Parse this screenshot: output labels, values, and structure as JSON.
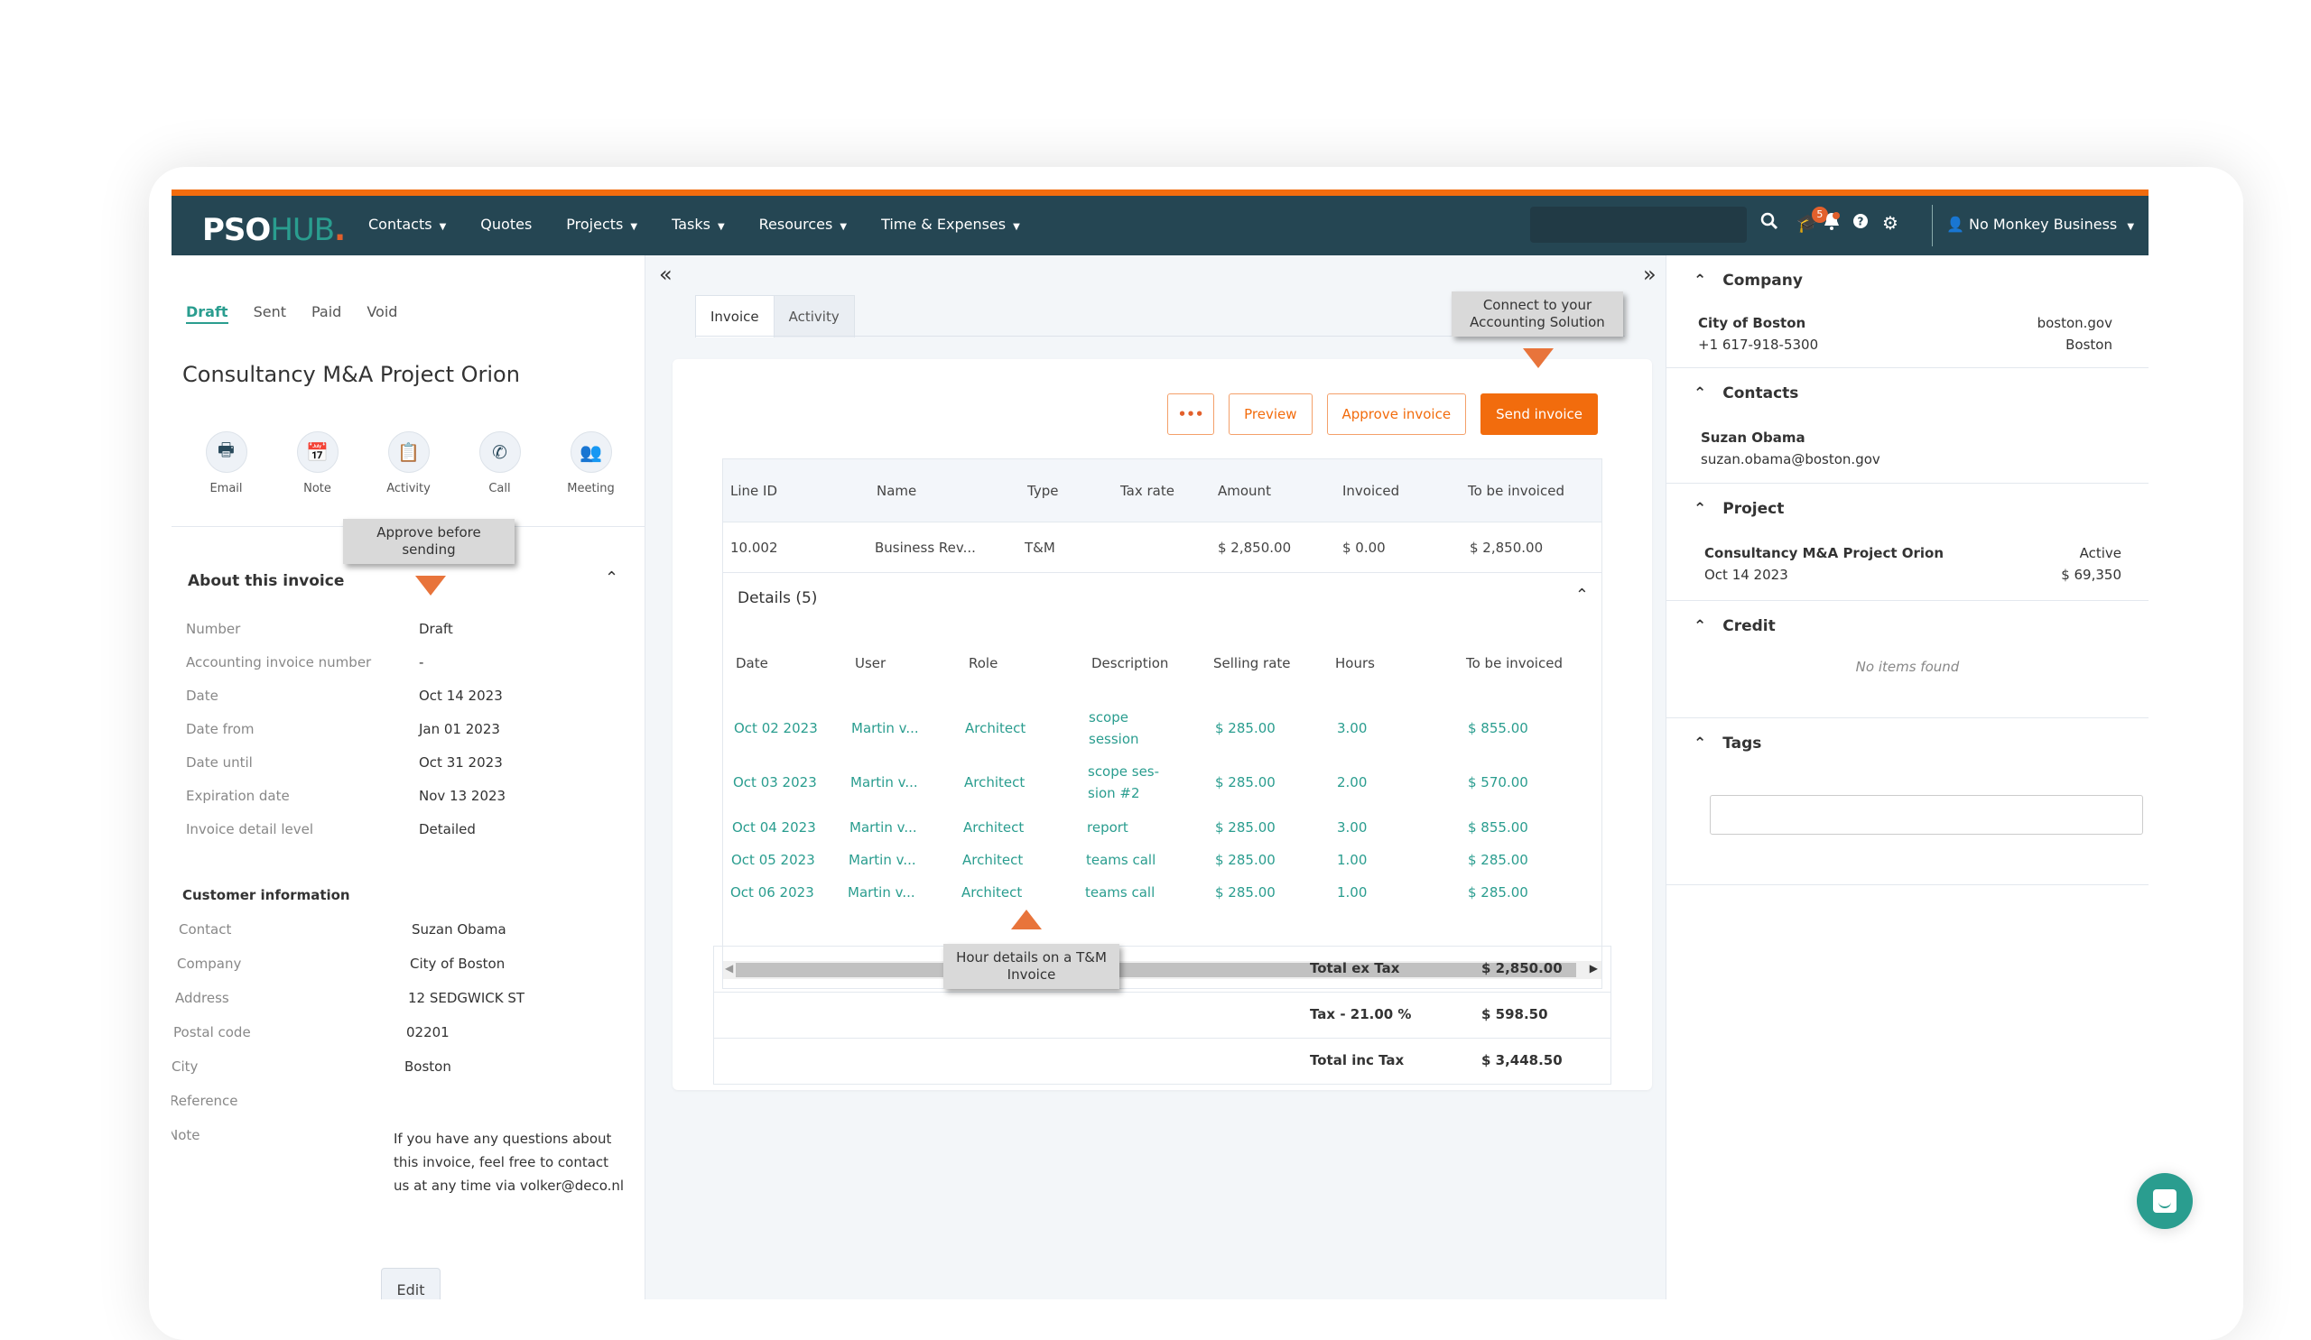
{
  "brand": {
    "pso": "PSO",
    "hub": "HUB",
    "dot": ".",
    "accent": "#f26c0d",
    "teal": "#2a9d8f",
    "navbar_bg": "#254653"
  },
  "nav": {
    "items": [
      {
        "label": "Contacts",
        "dropdown": true
      },
      {
        "label": "Quotes",
        "dropdown": false
      },
      {
        "label": "Projects",
        "dropdown": true
      },
      {
        "label": "Tasks",
        "dropdown": true
      },
      {
        "label": "Resources",
        "dropdown": true
      },
      {
        "label": "Time & Expenses",
        "dropdown": true
      }
    ],
    "search_icon": "search-icon",
    "notification_count": "5",
    "user_label": "No Monkey Business"
  },
  "left": {
    "status_tabs": [
      "Draft",
      "Sent",
      "Paid",
      "Void"
    ],
    "active_status": "Draft",
    "title": "Consultancy M&A Project Orion",
    "actions": [
      "Email",
      "Note",
      "Activity",
      "Call",
      "Meeting"
    ],
    "tooltip": "Approve before sending",
    "about_title": "About this invoice",
    "about": [
      {
        "k": "Number",
        "v": "Draft"
      },
      {
        "k": "Accounting invoice number",
        "v": "-"
      },
      {
        "k": "Date",
        "v": "Oct 14 2023"
      },
      {
        "k": "Date from",
        "v": "Jan 01 2023"
      },
      {
        "k": "Date until",
        "v": "Oct 31 2023"
      },
      {
        "k": "Expiration date",
        "v": "Nov 13 2023"
      },
      {
        "k": "Invoice detail level",
        "v": "Detailed"
      }
    ],
    "customer_title": "Customer information",
    "customer": [
      {
        "k": "Contact",
        "v": "Suzan Obama"
      },
      {
        "k": "Company",
        "v": "City of Boston"
      },
      {
        "k": "Address",
        "v": "12 SEDGWICK ST"
      },
      {
        "k": "Postal code",
        "v": "02201"
      },
      {
        "k": "City",
        "v": "Boston"
      },
      {
        "k": "Reference",
        "v": ""
      },
      {
        "k": "Note",
        "v": "If you have any questions about this invoice, feel free to contact us at any time via volker@deco.nl"
      }
    ],
    "edit_label": "Edit"
  },
  "center": {
    "tabs": [
      "Invoice",
      "Activity"
    ],
    "active_tab": "Invoice",
    "tooltip_accounting": "Connect to your Accounting Solution",
    "buttons": {
      "more": "•••",
      "preview": "Preview",
      "approve": "Approve invoice",
      "send": "Send invoice"
    },
    "line_headers": [
      "Line ID",
      "Name",
      "Type",
      "Tax rate",
      "Amount",
      "Invoiced",
      "To be invoiced"
    ],
    "line_row": [
      "10.002",
      "Business Rev...",
      "T&M",
      "",
      "$ 2,850.00",
      "$ 0.00",
      "$ 2,850.00"
    ],
    "details_title": "Details (5)",
    "detail_headers": [
      "Date",
      "User",
      "Role",
      "Description",
      "Selling rate",
      "Hours",
      "To be invoiced"
    ],
    "detail_rows": [
      [
        "Oct 02 2023",
        "Martin v...",
        "Architect",
        "scope session",
        "$ 285.00",
        "3.00",
        "$ 855.00"
      ],
      [
        "Oct 03 2023",
        "Martin v...",
        "Architect",
        "scope ses-sion #2",
        "$ 285.00",
        "2.00",
        "$ 570.00"
      ],
      [
        "Oct 04 2023",
        "Martin v...",
        "Architect",
        "report",
        "$ 285.00",
        "3.00",
        "$ 855.00"
      ],
      [
        "Oct 05 2023",
        "Martin v...",
        "Architect",
        "teams call",
        "$ 285.00",
        "1.00",
        "$ 285.00"
      ],
      [
        "Oct 06 2023",
        "Martin v...",
        "Architect",
        "teams call",
        "$ 285.00",
        "1.00",
        "$ 285.00"
      ]
    ],
    "tooltip_hours": "Hour details on a T&M Invoice",
    "totals": [
      {
        "label": "Total ex Tax",
        "value": "$ 2,850.00"
      },
      {
        "label": "Tax - 21.00 %",
        "value": "$ 598.50"
      },
      {
        "label": "Total inc Tax",
        "value": "$ 3,448.50"
      }
    ]
  },
  "right": {
    "company": {
      "title": "Company",
      "name": "City of Boston",
      "phone": "+1 617-918-5300",
      "website": "boston.gov",
      "city": "Boston"
    },
    "contacts": {
      "title": "Contacts",
      "name": "Suzan Obama",
      "email": "suzan.obama@boston.gov"
    },
    "project": {
      "title": "Project",
      "name": "Consultancy M&A Project Orion",
      "date": "Oct 14 2023",
      "status": "Active",
      "value": "$ 69,350"
    },
    "credit": {
      "title": "Credit",
      "empty": "No items found"
    },
    "tags": {
      "title": "Tags",
      "value": ""
    }
  }
}
